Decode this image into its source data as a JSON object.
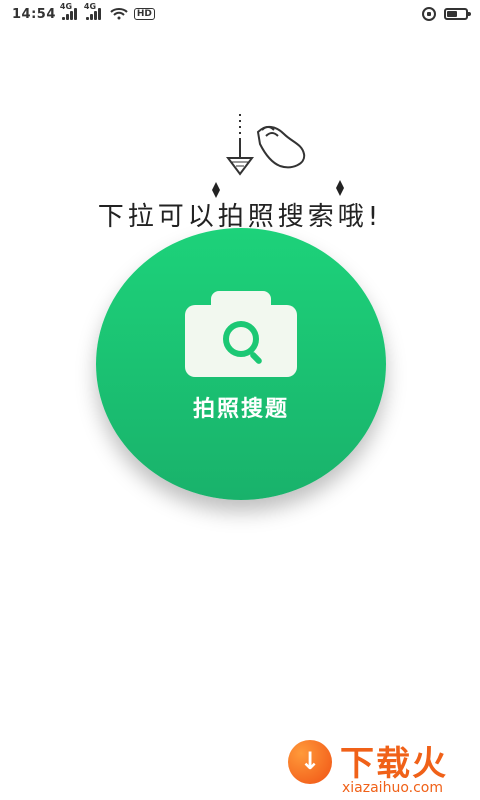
{
  "status_bar": {
    "time": "14:54",
    "network_1": "4G",
    "network_2": "4G",
    "hd_label": "HD",
    "battery_level": 0.55
  },
  "hint": {
    "text": "下拉可以拍照搜索哦!"
  },
  "main_action": {
    "label": "拍照搜题",
    "colors": {
      "top": "#1dd27a",
      "bottom": "#19b26b"
    }
  },
  "watermark": {
    "title": "下载火",
    "url": "xiazaihuo.com"
  }
}
